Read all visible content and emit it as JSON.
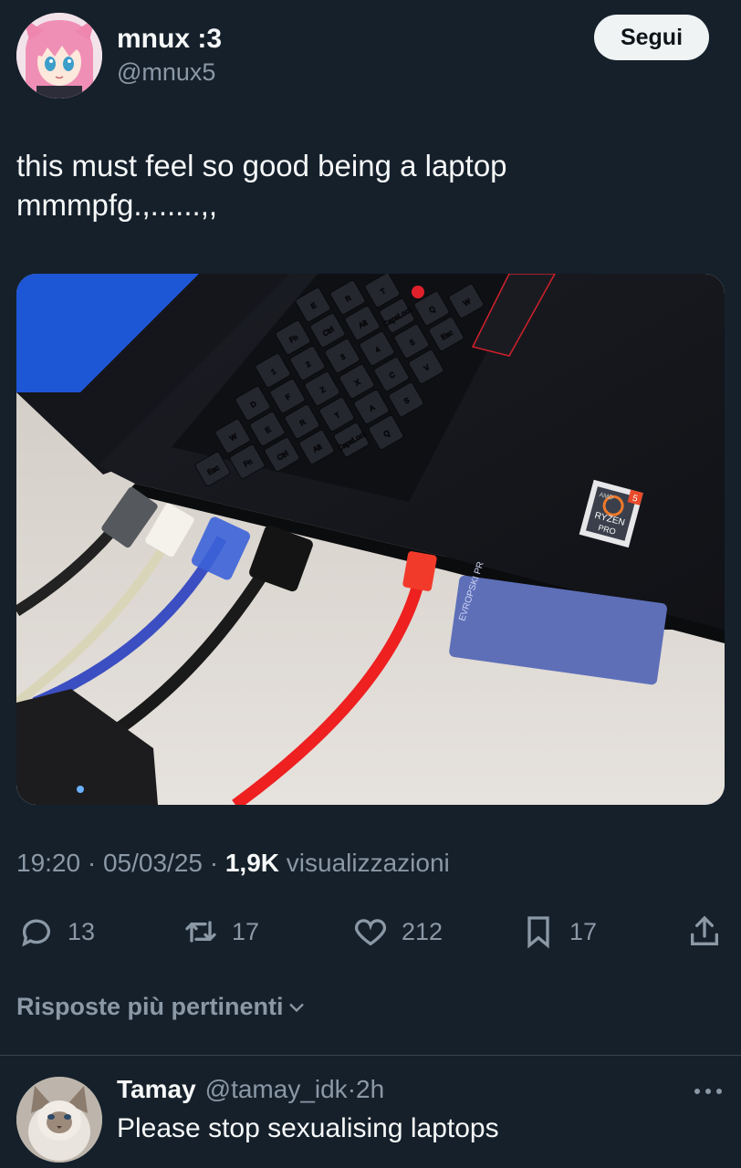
{
  "author": {
    "name": "mnux :3",
    "handle": "@mnux5"
  },
  "follow_label": "Segui",
  "tweet": {
    "text": "this must feel so good being a laptop\nmmmpfg.,......,,"
  },
  "photo": {
    "keys": [
      "Esc",
      "Fn",
      "Ctrl",
      "Alt",
      "CapsLock",
      "Q",
      "W",
      "E",
      "R",
      "T",
      "A",
      "S",
      "D",
      "F",
      "Z",
      "X",
      "C",
      "V",
      "1",
      "2",
      "3",
      "4",
      "5"
    ],
    "sticker_brand": "AMD",
    "sticker_title": "RYZEN",
    "sticker_sub": "PRO",
    "sticker_num": "5",
    "card_text": "EVROPSKI PR"
  },
  "meta": {
    "time": "19:20",
    "date": "05/03/25",
    "views": "1,9K",
    "views_label": "visualizzazioni"
  },
  "actions": {
    "replies": "13",
    "reposts": "17",
    "likes": "212",
    "bookmarks": "17"
  },
  "colors": {
    "background": "#15202b",
    "secondary_text": "#8b98a5"
  },
  "relevant_label": "Risposte più pertinenti",
  "reply": {
    "name": "Tamay",
    "handle": "@tamay_idk",
    "time": "2h",
    "text": "Please stop sexualising laptops"
  }
}
